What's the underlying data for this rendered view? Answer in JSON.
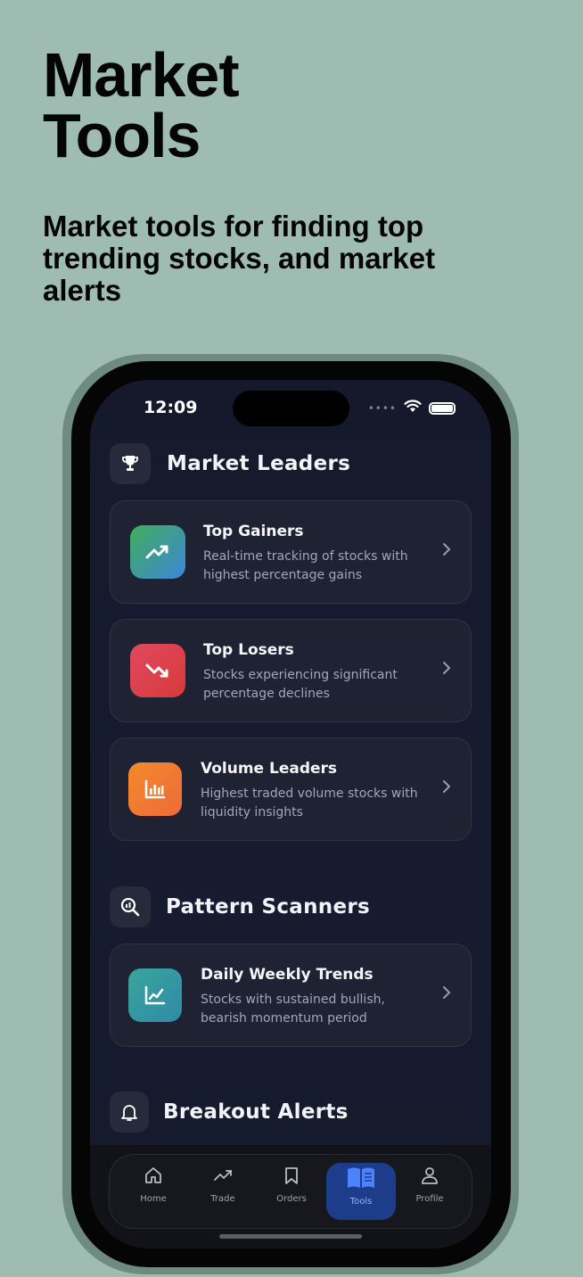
{
  "hero": {
    "title_line1": "Market",
    "title_line2": "Tools",
    "subtitle": "Market tools for finding top trending stocks, and market alerts"
  },
  "status_bar": {
    "time": "12:09",
    "signal": "••••"
  },
  "sections": {
    "market_leaders": {
      "title": "Market Leaders",
      "icon": "trophy-icon",
      "cards": [
        {
          "title": "Top Gainers",
          "description": "Real-time tracking of stocks with highest percentage gains",
          "icon": "trending-up-icon",
          "gradient": [
            "#3fae5a",
            "#3f86d8"
          ]
        },
        {
          "title": "Top Losers",
          "description": "Stocks experiencing significant percentage declines",
          "icon": "trending-down-icon",
          "gradient": [
            "#e0495f",
            "#d83a3a"
          ]
        },
        {
          "title": "Volume Leaders",
          "description": "Highest traded volume stocks with liquidity insights",
          "icon": "bar-chart-icon",
          "gradient": [
            "#f38a2c",
            "#ef6a3a"
          ]
        }
      ]
    },
    "pattern_scanners": {
      "title": "Pattern Scanners",
      "icon": "magnify-chart-icon",
      "cards": [
        {
          "title": "Daily Weekly Trends",
          "description": "Stocks with sustained bullish, bearish momentum period",
          "icon": "line-chart-icon",
          "gradient": [
            "#3aa59b",
            "#2f8aa8"
          ]
        }
      ]
    },
    "breakout_alerts": {
      "title": "Breakout Alerts",
      "icon": "bell-icon"
    }
  },
  "bottom_nav": {
    "items": [
      {
        "label": "Home",
        "icon": "home-icon"
      },
      {
        "label": "Trade",
        "icon": "trend-icon"
      },
      {
        "label": "Orders",
        "icon": "bookmark-icon"
      },
      {
        "label": "Tools",
        "icon": "book-icon",
        "active": true
      },
      {
        "label": "Profile",
        "icon": "person-icon"
      }
    ]
  },
  "colors": {
    "page_background": "#9ebcb1",
    "screen_background": "#161a2c",
    "card_background": "#1f2232",
    "active_tab": "#1d3c8a"
  }
}
